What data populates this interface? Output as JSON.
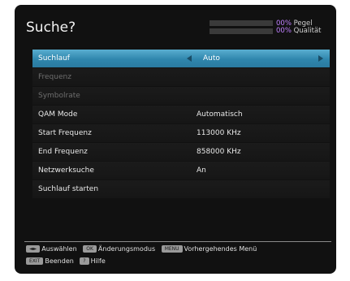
{
  "screen": {
    "title": "Suche?",
    "signal": {
      "percent": "00%",
      "label": "Pegel",
      "level": 0
    },
    "quality": {
      "percent": "00%",
      "label": "Qualität",
      "level": 0
    }
  },
  "menu": {
    "rows": [
      {
        "label": "Suchlauf",
        "value": "Auto",
        "state": "selected"
      },
      {
        "label": "Frequenz",
        "value": "",
        "state": "disabled"
      },
      {
        "label": "Symbolrate",
        "value": "",
        "state": "disabled"
      },
      {
        "label": "QAM Mode",
        "value": "Automatisch",
        "state": "normal"
      },
      {
        "label": "Start Frequenz",
        "value": "113000 KHz",
        "state": "normal"
      },
      {
        "label": "End Frequenz",
        "value": "858000 KHz",
        "state": "normal"
      },
      {
        "label": "Netzwerksuche",
        "value": "An",
        "state": "normal"
      },
      {
        "label": "Suchlauf starten",
        "value": "",
        "state": "normal"
      }
    ]
  },
  "footer": {
    "select": {
      "key": "◄►",
      "label": "Auswählen"
    },
    "edit": {
      "key": "OK",
      "label": "Änderungsmodus"
    },
    "back": {
      "key": "MENU",
      "label": "Vorhergehendes Menü"
    },
    "exit": {
      "key": "EXIT",
      "label": "Beenden"
    },
    "help": {
      "key": "?",
      "label": "Hilfe"
    }
  },
  "colors": {
    "accent": "#2f86ad",
    "percent": "#c080ff",
    "background": "#111111"
  }
}
